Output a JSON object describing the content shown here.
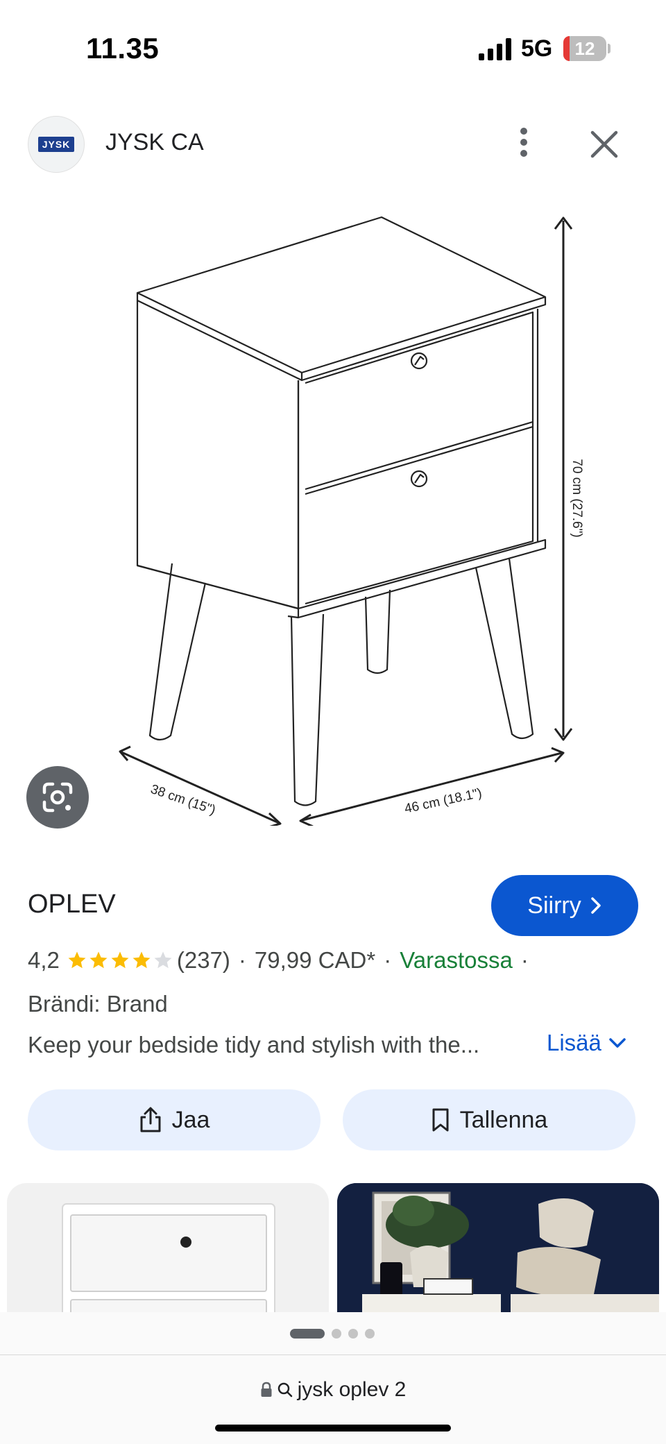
{
  "status_bar": {
    "time": "11.35",
    "network": "5G",
    "battery": "12"
  },
  "header": {
    "logo_text": "JYSK",
    "site_name": "JYSK CA"
  },
  "image": {
    "dimension_height": "70 cm (27.6\")",
    "dimension_depth": "38 cm (15\")",
    "dimension_width": "46 cm (18.1\")"
  },
  "product": {
    "title": "OPLEV",
    "goto_label": "Siirry",
    "rating": "4,2",
    "stars_filled": 4,
    "review_count": "(237)",
    "price": "79,99 CAD*",
    "availability": "Varastossa",
    "brand": "Brändi: Brand",
    "description": "Keep your bedside tidy and stylish with the...",
    "more_label": "Lisää"
  },
  "actions": {
    "share_label": "Jaa",
    "save_label": "Tallenna"
  },
  "pager": {
    "count": 4,
    "active": 0
  },
  "bottom": {
    "url": "jysk oplev 2"
  },
  "colors": {
    "primary_button": "#0b57d0",
    "tonal_button": "#e8f0fe",
    "in_stock": "#188038",
    "star": "#fbbc04"
  }
}
